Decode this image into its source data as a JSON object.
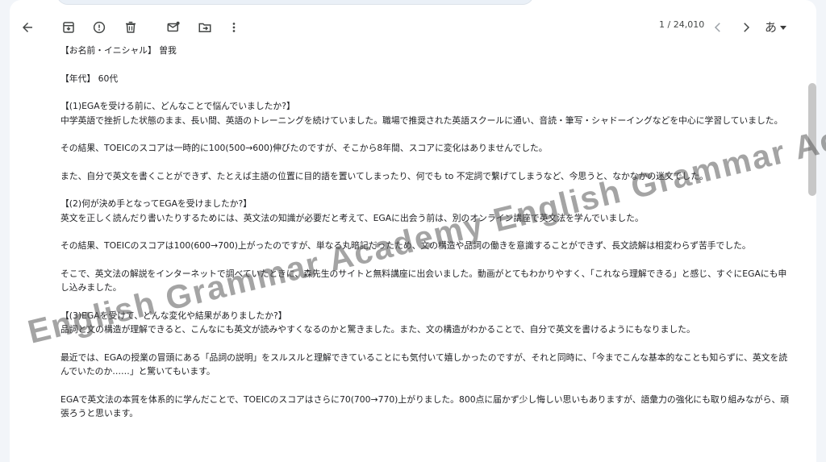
{
  "toolbar": {
    "counter": "1 / 24,010",
    "language_label": "あ",
    "icons": [
      "back-arrow-icon",
      "archive-icon",
      "report-spam-icon",
      "delete-icon",
      "mark-unread-icon",
      "move-to-icon",
      "more-vert-icon",
      "prev-icon",
      "next-icon"
    ]
  },
  "message": {
    "name_line": "【お名前・イニシャル】 曽我",
    "age_line": "【年代】 60代",
    "q1_heading": "【(1)EGAを受ける前に、どんなことで悩んでいましたか?】",
    "q1_p1": "中学英語で挫折した状態のまま、長い間、英語のトレーニングを続けていました。職場で推奨された英語スクールに通い、音読・筆写・シャドーイングなどを中心に学習していました。",
    "q1_p2": "その結果、TOEICのスコアは一時的に100(500→600)伸びたのですが、そこから8年間、スコアに変化はありませんでした。",
    "q1_p3": "また、自分で英文を書くことができず、たとえば主語の位置に目的語を置いてしまったり、何でも to 不定詞で繋げてしまうなど、今思うと、なかなかの迷文でした。",
    "q2_heading": "【(2)何が決め手となってEGAを受けましたか?】",
    "q2_p1": "英文を正しく読んだり書いたりするためには、英文法の知識が必要だと考えて、EGAに出会う前は、別のオンライン講座で英文法を学んでいました。",
    "q2_p2": "その結果、TOEICのスコアは100(600→700)上がったのですが、単なる丸暗記だったため、文の構造や品詞の働きを意識することができず、長文読解は相変わらず苦手でした。",
    "q2_p3": "そこで、英文法の解説をインターネットで調べていたときに、森先生のサイトと無料講座に出会いました。動画がとてもわかりやすく、「これなら理解できる」と感じ、すぐにEGAにも申し込みました。",
    "q3_heading": "【(3)EGAを受けて、どんな変化や結果がありましたか?】",
    "q3_p1": "品詞と文の構造が理解できると、こんなにも英文が読みやすくなるのかと驚きました。また、文の構造がわかることで、自分で英文を書けるようにもなりました。",
    "q3_p2": "最近では、EGAの授業の冒頭にある「品詞の説明」をスルスルと理解できていることにも気付いて嬉しかったのですが、それと同時に、「今までこんな基本的なことも知らずに、英文を読んでいたのか……」と驚いてもいます。",
    "q3_p3": "EGAで英文法の本質を体系的に学んだことで、TOEICのスコアはさらに70(700→770)上がりました。800点に届かず少し悔しい思いもありますが、語彙力の強化にも取り組みながら、頑張ろうと思います。"
  },
  "watermark": {
    "text": "English Grammar Academy English Grammar Academy"
  }
}
